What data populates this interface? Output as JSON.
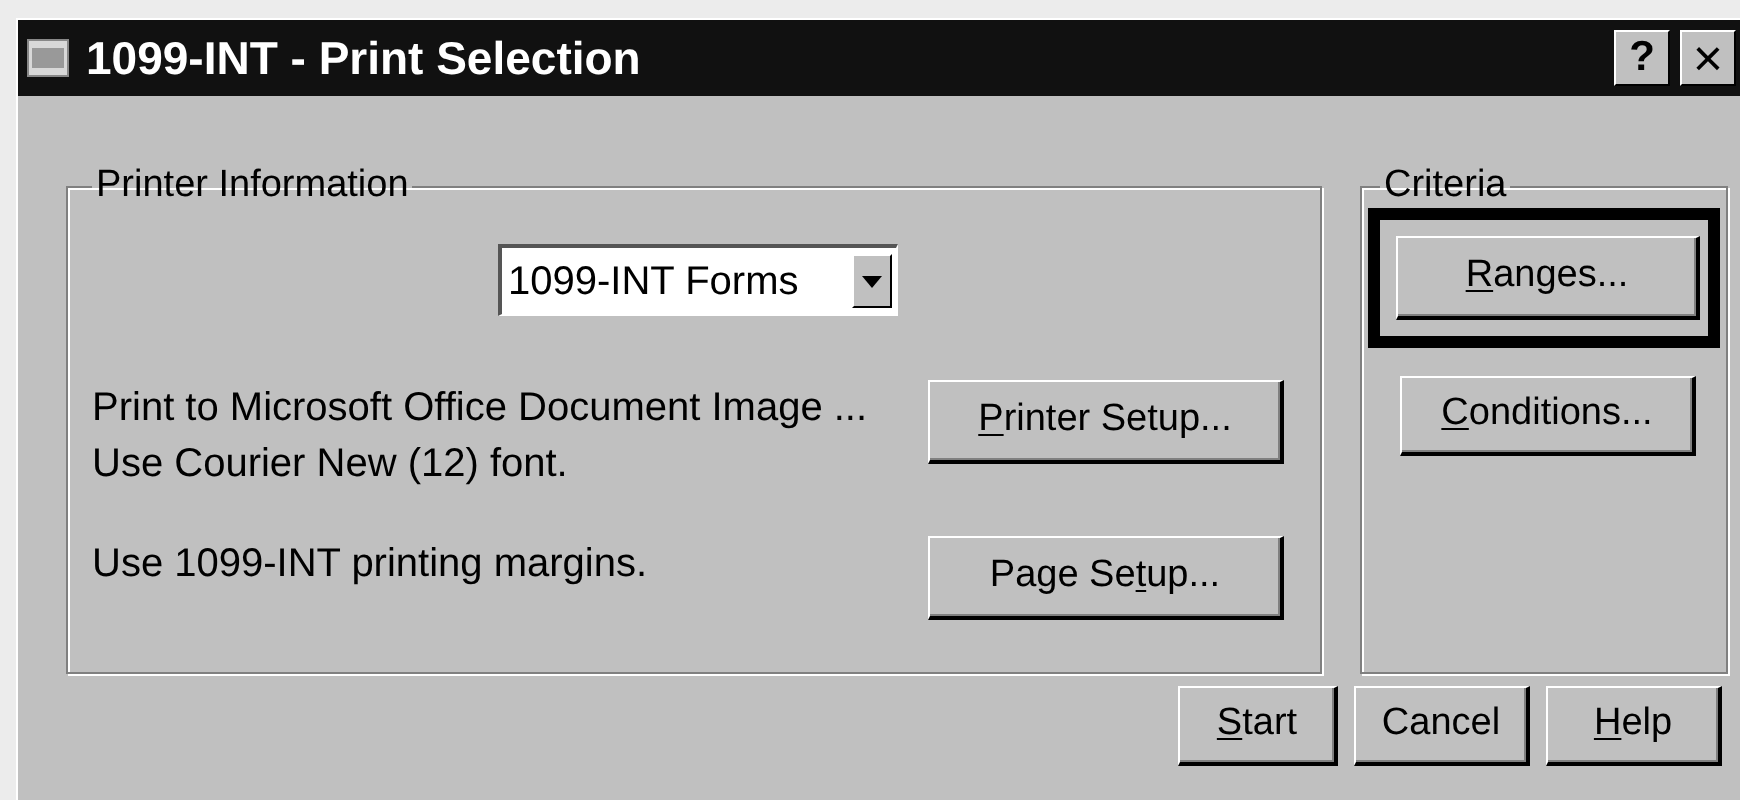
{
  "window": {
    "title": "1099-INT - Print Selection",
    "title_buttons": [
      {
        "kind": "help",
        "label": "?"
      },
      {
        "kind": "close",
        "label": "×"
      }
    ]
  },
  "printer_information": {
    "title": "Printer Information",
    "form_select": {
      "value": "1099-INT Forms"
    },
    "rows": [
      {
        "lines": [
          "Print to Microsoft Office Document Image ...",
          "Use Courier New (12) font."
        ],
        "button": {
          "mnemonic": "P",
          "after": "rinter Setup...",
          "default": false
        }
      },
      {
        "lines": [
          "Use 1099-INT printing margins."
        ],
        "button": {
          "before": "Page Se",
          "mnemonic": "t",
          "after": "up...",
          "default": false
        }
      }
    ]
  },
  "criteria": {
    "title": "Criteria",
    "buttons": [
      {
        "mnemonic": "R",
        "after": "anges...",
        "default": true
      },
      {
        "mnemonic": "C",
        "after": "onditions...",
        "default": false
      }
    ]
  },
  "footer_buttons": [
    {
      "mnemonic": "S",
      "after": "tart",
      "default": false
    },
    {
      "label": "Cancel",
      "default": false
    },
    {
      "mnemonic": "H",
      "after": "elp",
      "default": false
    }
  ]
}
